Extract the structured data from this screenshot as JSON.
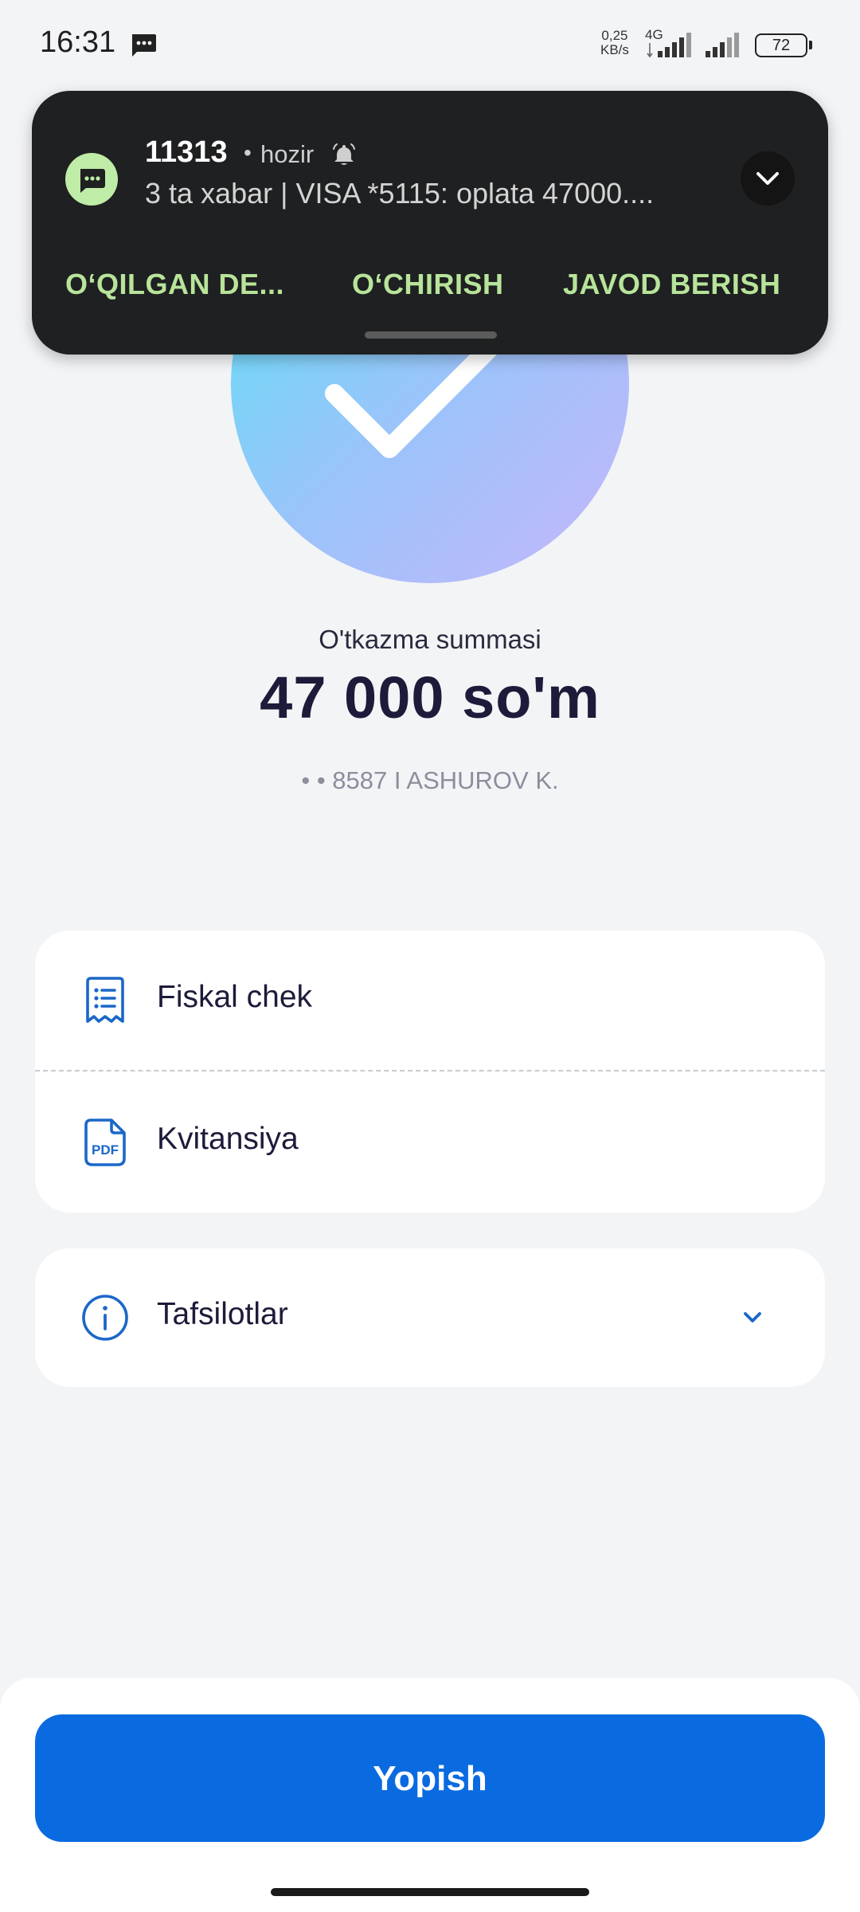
{
  "status_bar": {
    "time": "16:31",
    "net_speed_value": "0,25",
    "net_speed_unit": "KB/s",
    "net_type": "4G",
    "battery": "72",
    "icons": [
      "message-icon",
      "signal-icon",
      "signal-icon",
      "battery-icon"
    ]
  },
  "notification": {
    "sender": "11313",
    "separator": "•",
    "time": "hozir",
    "body": "3 ta xabar | VISA *5115: oplata 47000....",
    "actions": {
      "read": "O‘QILGAN DE...",
      "delete": "O‘CHIRISH",
      "reply": "JAVOD BERISH"
    },
    "colors": {
      "background": "#1f2021",
      "action": "#b7e49a",
      "app_icon": "#bfeca6"
    }
  },
  "transfer": {
    "label": "O'tkazma summasi",
    "amount": "47 000 so'm",
    "recipient": "• • 8587 I ASHUROV K."
  },
  "documents": {
    "fiscal_check": "Fiskal chek",
    "receipt": "Kvitansiya"
  },
  "details": {
    "label": "Tafsilotlar"
  },
  "footer": {
    "close_label": "Yopish"
  },
  "colors": {
    "accent": "#0a6be0",
    "page_background": "#f3f4f6",
    "success_gradient": [
      "#5ce1f6",
      "#9ac4fa",
      "#c5b6fb"
    ]
  }
}
